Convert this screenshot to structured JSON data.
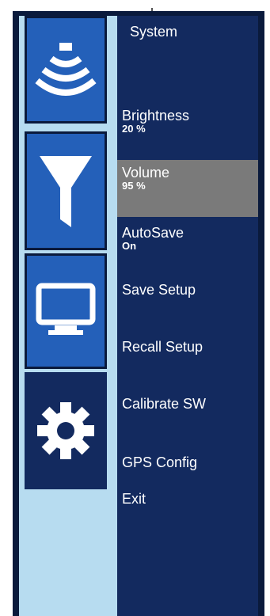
{
  "section_title": "System",
  "tabs": [
    {
      "icon": "sonar-icon"
    },
    {
      "icon": "filter-funnel-icon"
    },
    {
      "icon": "display-monitor-icon"
    },
    {
      "icon": "gear-icon"
    }
  ],
  "menu": [
    {
      "label": "Brightness",
      "value": "20 %"
    },
    {
      "label": "Volume",
      "value": "95 %"
    },
    {
      "label": "AutoSave",
      "value": "On"
    },
    {
      "label": "Save Setup"
    },
    {
      "label": "Recall Setup"
    },
    {
      "label": "Calibrate SW"
    },
    {
      "label": "GPS Config"
    },
    {
      "label": "Exit"
    }
  ],
  "colors": {
    "panel_dark": "#132a5f",
    "tab_blue": "#2460b9",
    "selected_gray": "#7a7a7a",
    "side_light": "#b7dcf0"
  }
}
